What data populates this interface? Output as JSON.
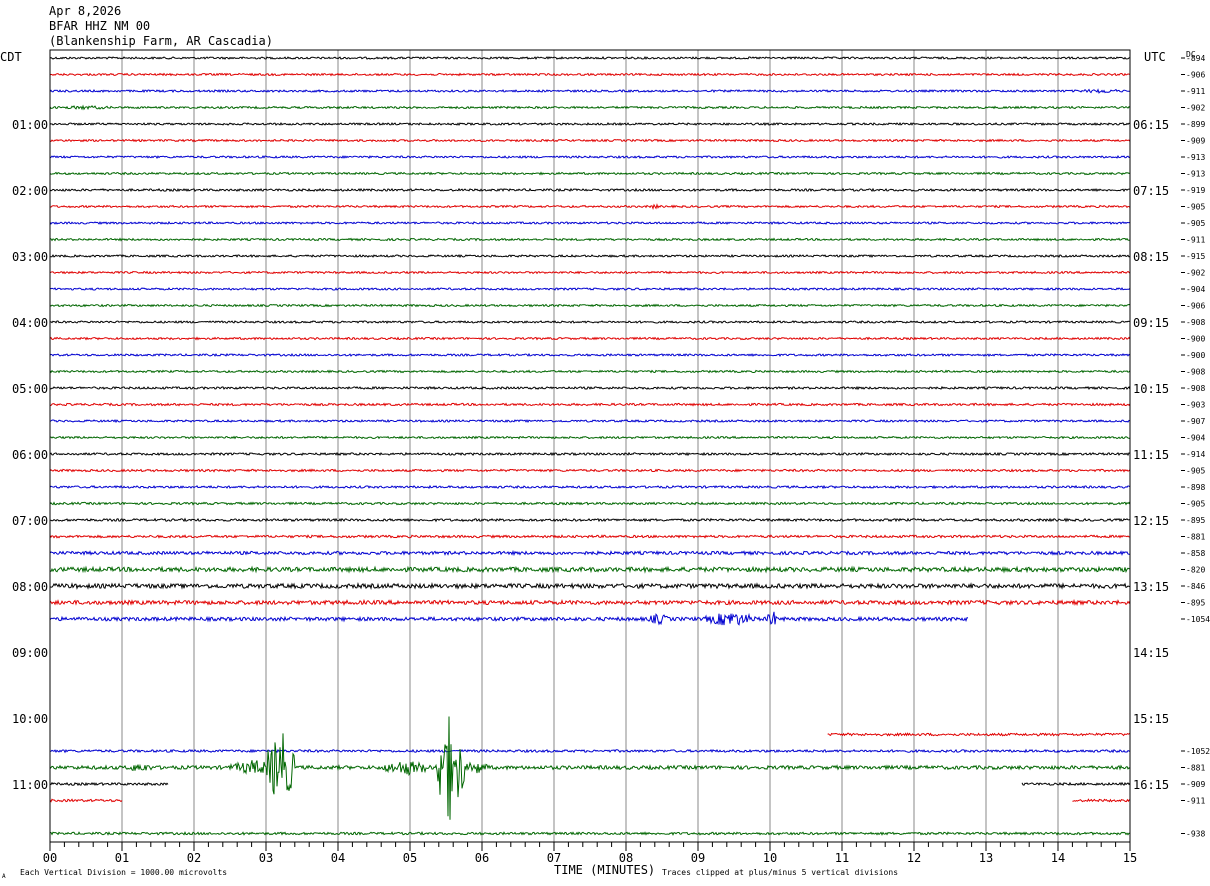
{
  "header": {
    "date": "Apr 8,2026",
    "station": "BFAR HHZ NM 00",
    "location": "(Blankenship Farm, AR Cascadia)"
  },
  "footer": {
    "scale_note": "Each Vertical Division = 1000.00 microvolts",
    "clip_note": "Traces clipped at plus/minus 5 vertical divisions",
    "corner_mark": "A"
  },
  "chart_data": {
    "type": "line",
    "title": "",
    "xlabel": "TIME (MINUTES)",
    "ylabel_left": "CDT",
    "ylabel_right": "UTC",
    "dc_label": "DC",
    "xlim": [
      0,
      15
    ],
    "x_ticks": [
      "00",
      "01",
      "02",
      "03",
      "04",
      "05",
      "06",
      "07",
      "08",
      "09",
      "10",
      "11",
      "12",
      "13",
      "14",
      "15"
    ],
    "left_hour_labels": [
      "01:00",
      "02:00",
      "03:00",
      "04:00",
      "05:00",
      "06:00",
      "07:00",
      "08:00",
      "09:00",
      "10:00",
      "11:00"
    ],
    "right_hour_labels": [
      "06:15",
      "07:15",
      "08:15",
      "09:15",
      "10:15",
      "11:15",
      "12:15",
      "13:15",
      "14:15",
      "15:15",
      "16:15"
    ],
    "line_colors": [
      "#000000",
      "#e00000",
      "#0000d0",
      "#006600"
    ],
    "grid": true,
    "rows": [
      {
        "dc": "-894",
        "start": 0,
        "end": 15,
        "amp": 1
      },
      {
        "dc": "-906",
        "start": 0,
        "end": 15,
        "amp": 1
      },
      {
        "dc": "-911",
        "start": 0,
        "end": 15,
        "amp": 1,
        "extra": [
          [
            14.2,
            15,
            2.2
          ]
        ]
      },
      {
        "dc": "-902",
        "start": 0,
        "end": 15,
        "amp": 1,
        "extra": [
          [
            0,
            1.0,
            2
          ]
        ]
      },
      {
        "dc": "-899",
        "start": 0,
        "end": 15,
        "amp": 1
      },
      {
        "dc": "-909",
        "start": 0,
        "end": 15,
        "amp": 1
      },
      {
        "dc": "-913",
        "start": 0,
        "end": 15,
        "amp": 1
      },
      {
        "dc": "-913",
        "start": 0,
        "end": 15,
        "amp": 1
      },
      {
        "dc": "-919",
        "start": 0,
        "end": 15,
        "amp": 1.1
      },
      {
        "dc": "-905",
        "start": 0,
        "end": 15,
        "amp": 1,
        "extra": [
          [
            8.35,
            8.45,
            3
          ]
        ]
      },
      {
        "dc": "-905",
        "start": 0,
        "end": 15,
        "amp": 1
      },
      {
        "dc": "-911",
        "start": 0,
        "end": 15,
        "amp": 1
      },
      {
        "dc": "-915",
        "start": 0,
        "end": 15,
        "amp": 1
      },
      {
        "dc": "-902",
        "start": 0,
        "end": 15,
        "amp": 1
      },
      {
        "dc": "-904",
        "start": 0,
        "end": 15,
        "amp": 1
      },
      {
        "dc": "-906",
        "start": 0,
        "end": 15,
        "amp": 1
      },
      {
        "dc": "-908",
        "start": 0,
        "end": 15,
        "amp": 1
      },
      {
        "dc": "-900",
        "start": 0,
        "end": 15,
        "amp": 1
      },
      {
        "dc": "-900",
        "start": 0,
        "end": 15,
        "amp": 1
      },
      {
        "dc": "-908",
        "start": 0,
        "end": 15,
        "amp": 1
      },
      {
        "dc": "-908",
        "start": 0,
        "end": 15,
        "amp": 1.1
      },
      {
        "dc": "-903",
        "start": 0,
        "end": 15,
        "amp": 1.1
      },
      {
        "dc": "-907",
        "start": 0,
        "end": 15,
        "amp": 1
      },
      {
        "dc": "-904",
        "start": 0,
        "end": 15,
        "amp": 1
      },
      {
        "dc": "-914",
        "start": 0,
        "end": 15,
        "amp": 1.1
      },
      {
        "dc": "-905",
        "start": 0,
        "end": 15,
        "amp": 1.1
      },
      {
        "dc": "-898",
        "start": 0,
        "end": 15,
        "amp": 1.1
      },
      {
        "dc": "-905",
        "start": 0,
        "end": 15,
        "amp": 1.1
      },
      {
        "dc": "-895",
        "start": 0,
        "end": 15,
        "amp": 1.2
      },
      {
        "dc": "-881",
        "start": 0,
        "end": 15,
        "amp": 1.2
      },
      {
        "dc": "-858",
        "start": 0,
        "end": 15,
        "amp": 1.6
      },
      {
        "dc": "-820",
        "start": 0,
        "end": 15,
        "amp": 2.2
      },
      {
        "dc": "-846",
        "start": 0,
        "end": 15,
        "amp": 2.2
      },
      {
        "dc": "-895",
        "start": 0,
        "end": 15,
        "amp": 2
      },
      {
        "dc": "-1054",
        "start": 0,
        "end": 12.75,
        "amp": 1.8,
        "extra": [
          [
            8.3,
            8.6,
            6
          ],
          [
            9.1,
            9.8,
            8
          ],
          [
            9.95,
            10.1,
            10
          ]
        ]
      },
      {
        "dc": "",
        "start": null,
        "end": null,
        "amp": 0
      },
      {
        "dc": "",
        "start": null,
        "end": null,
        "amp": 0
      },
      {
        "dc": "",
        "start": null,
        "end": null,
        "amp": 0
      },
      {
        "dc": "",
        "start": null,
        "end": null,
        "amp": 0
      },
      {
        "dc": "",
        "start": null,
        "end": null,
        "amp": 0
      },
      {
        "dc": "",
        "start": null,
        "end": null,
        "amp": 0
      },
      {
        "dc": "",
        "start": 10.8,
        "end": 15,
        "amp": 1.2
      },
      {
        "dc": "-1052",
        "start": 0,
        "end": 15,
        "amp": 1.2
      },
      {
        "dc": "-881",
        "start": 0,
        "end": 15,
        "amp": 1.8,
        "extra": [
          [
            1.05,
            1.45,
            5
          ],
          [
            2.5,
            3.2,
            8
          ],
          [
            3.0,
            3.4,
            40
          ],
          [
            4.6,
            5.3,
            8
          ],
          [
            5.35,
            5.75,
            55
          ],
          [
            5.75,
            6.1,
            7
          ]
        ]
      },
      {
        "dc": "-909",
        "start": 0,
        "end": 1.65,
        "amp": 1.2,
        "segments": [
          [
            0,
            1.65
          ],
          [
            13.5,
            15
          ]
        ]
      },
      {
        "dc": "-911",
        "start": 0,
        "end": 1.0,
        "amp": 1.2,
        "segments": [
          [
            0,
            1.0
          ],
          [
            14.2,
            15
          ]
        ]
      },
      {
        "dc": "",
        "start": null,
        "end": null,
        "amp": 0
      },
      {
        "dc": "-938",
        "start": 0,
        "end": 15,
        "amp": 1.2
      }
    ]
  }
}
